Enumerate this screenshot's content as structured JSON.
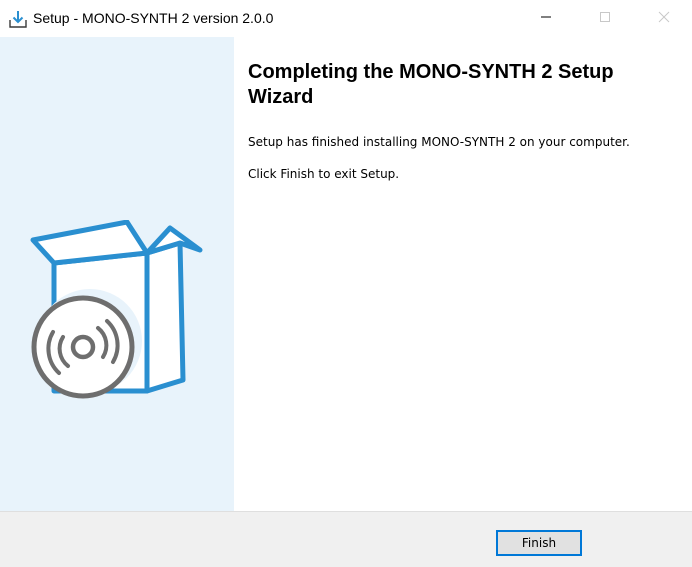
{
  "window": {
    "title": "Setup - MONO-SYNTH 2 version 2.0.0",
    "app_icon": "installer-download-icon",
    "controls": [
      "minimize-icon",
      "maximize-icon",
      "close-icon"
    ]
  },
  "side_panel": {
    "illustration": "software-box-with-disc-icon",
    "background_color": "#e8f3fb",
    "accent_color": "#2a8fd0"
  },
  "main": {
    "heading": "Completing the MONO-SYNTH 2 Setup Wizard",
    "message_installed": "Setup has finished installing MONO-SYNTH 2 on your computer.",
    "message_exit": "Click Finish to exit Setup."
  },
  "footer": {
    "finish_label": "Finish"
  }
}
